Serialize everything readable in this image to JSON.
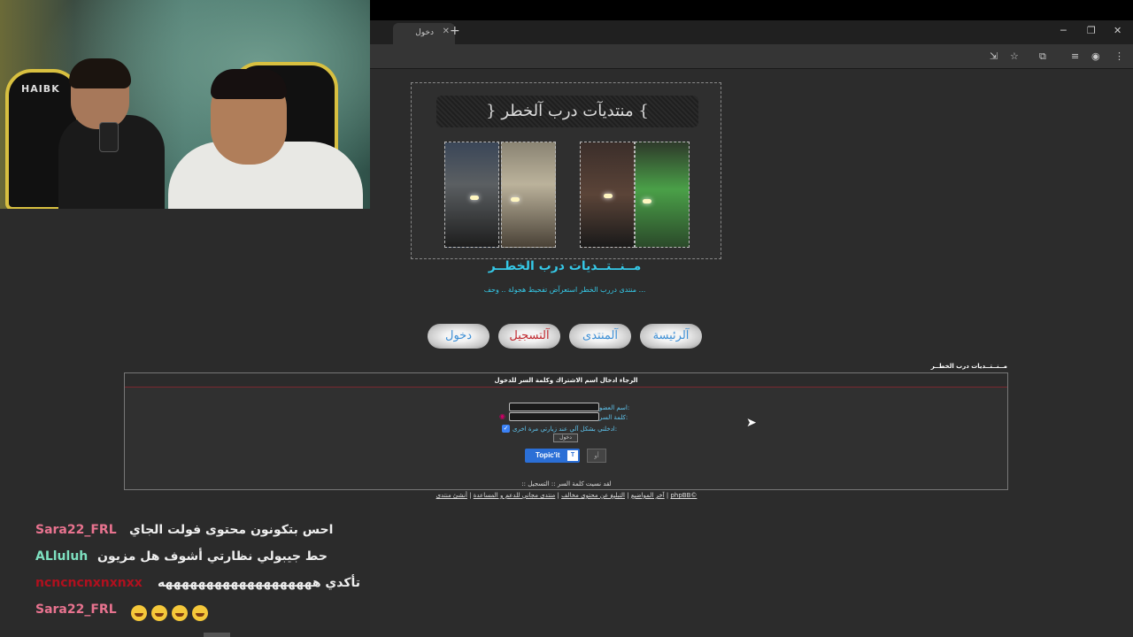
{
  "webcam": {
    "chair_logo": "HAIBK"
  },
  "browser": {
    "tab_title": "دخول",
    "new_tab": "+",
    "window_controls": {
      "minimize": "─",
      "maximize": "❐",
      "close": "✕"
    }
  },
  "forum": {
    "banner_title": "} منتديآت درب آلخطر {",
    "name": "مــنــتــديات درب الخطــر",
    "description": "منتدى دررب الخطر استعرآض تفحيط هجولة .. وحف ...",
    "nav": {
      "home": "آلرئيسة",
      "forum": "آلمنتدى",
      "register": "آلتسجيل",
      "login": "دخول"
    },
    "breadcrumb": "مــنــتــديات درب الخطــر"
  },
  "login_panel": {
    "header": "الرجاء ادخال اسم الاشتراك وكلمة السر للدخول",
    "username_label": "اسم العضو:",
    "password_label": "كلمة السر:",
    "remember_label": "ادخلني بشكل آلي عند زيارتي مرة اخرى:",
    "login_button": "دخول",
    "topicit_label": "Topic'it",
    "or_label": "أو"
  },
  "links": {
    "register": ":: التسجيل",
    "forgot": "::  لقد نسيت كلمة السر",
    "footer": [
      "phpBB©",
      "أنشئ منتدى",
      "منتدى مجاني للدعم و المساعدة",
      "التبليغ عن محتوى مخالف",
      "آخر المواضيع"
    ]
  },
  "chat": [
    {
      "user": "Sara22_FRL",
      "color": "#e8738f",
      "message": "احس بتكونون محتوى فولت الجاي"
    },
    {
      "user": "ALluluh",
      "color": "#7ee0c0",
      "message": "حط جيبولي نظارتي أشوف هل مزيون"
    },
    {
      "user": "ncncncnxnxnxx",
      "color": "#b0101e",
      "message": "تأكدي هههههههههههههههههههه"
    },
    {
      "user": "Sara22_FRL",
      "color": "#e8738f",
      "message": ""
    }
  ]
}
